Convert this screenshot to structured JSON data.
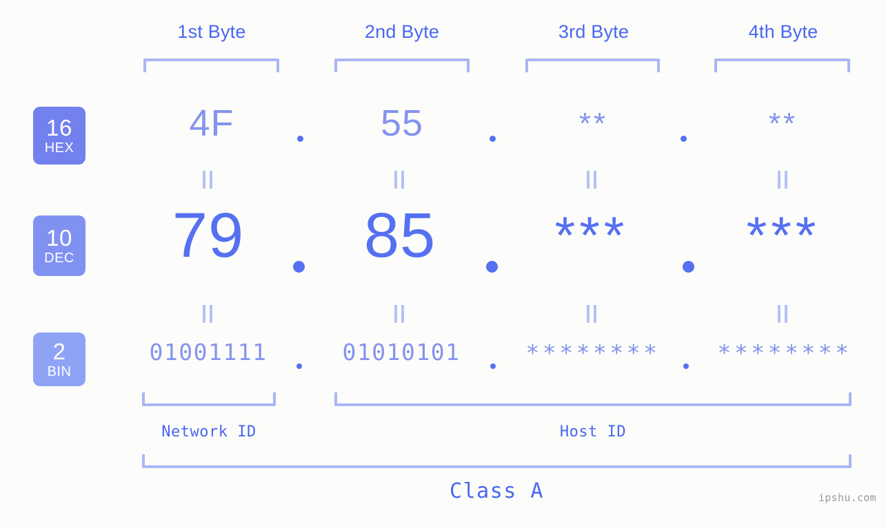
{
  "watermark": "ipshu.com",
  "byte_headers": [
    {
      "label": "1st Byte"
    },
    {
      "label": "2nd Byte"
    },
    {
      "label": "3rd Byte"
    },
    {
      "label": "4th Byte"
    }
  ],
  "radix_badges": [
    {
      "num": "16",
      "label": "HEX",
      "color": "#7281ee"
    },
    {
      "num": "10",
      "label": "DEC",
      "color": "#8191f2"
    },
    {
      "num": "2",
      "label": "BIN",
      "color": "#8fa3f5"
    }
  ],
  "rows": {
    "hex": {
      "radix": "16",
      "name": "HEX",
      "values": [
        "4F",
        "55",
        "**",
        "**"
      ],
      "separator": "."
    },
    "dec": {
      "radix": "10",
      "name": "DEC",
      "values": [
        "79",
        "85",
        "***",
        "***"
      ],
      "separator": "."
    },
    "bin": {
      "radix": "2",
      "name": "BIN",
      "values": [
        "01001111",
        "01010101",
        "********",
        "********"
      ],
      "separator": "."
    }
  },
  "equals_marks": {
    "upper": [
      "=",
      "=",
      "=",
      "="
    ],
    "lower": [
      "=",
      "=",
      "=",
      "="
    ]
  },
  "regions": {
    "network_id": "Network ID",
    "host_id": "Host ID"
  },
  "class": {
    "label": "Class A"
  },
  "colors": {
    "background": "#fcfdfa",
    "accent_strong": "#4a66f0",
    "accent_dec": "#5570f1",
    "accent_light": "#8493ee",
    "bracket": "#aab6f5",
    "equals": "#b6c1f7",
    "watermark": "#9a9a9a"
  }
}
